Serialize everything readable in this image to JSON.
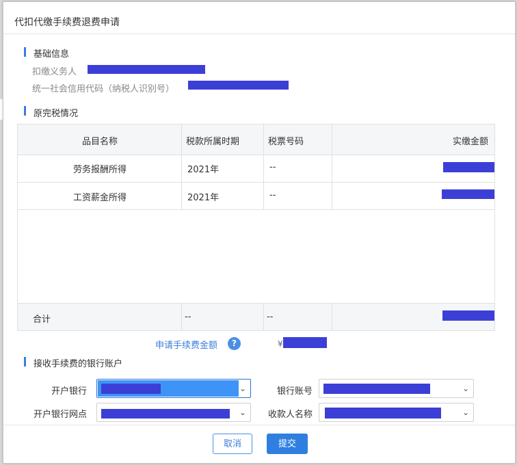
{
  "dialog": {
    "title": "代扣代缴手续费退费申请"
  },
  "basic_info": {
    "section_title": "基础信息",
    "withholder_label": "扣缴义务人",
    "credit_code_label": "统一社会信用代码（纳税人识别号）"
  },
  "tax_status": {
    "section_title": "原完税情况",
    "headers": [
      "品目名称",
      "税款所属时期",
      "税票号码",
      "实缴金额"
    ],
    "rows": [
      {
        "item": "劳务报酬所得",
        "period": "2021年",
        "ticket": "--"
      },
      {
        "item": "工资薪金所得",
        "period": "2021年",
        "ticket": "--"
      }
    ],
    "total": {
      "label": "合计",
      "period": "--",
      "ticket": "--"
    }
  },
  "fee": {
    "label": "申请手续费金额",
    "help_icon": "?",
    "currency": "¥"
  },
  "bank": {
    "section_title": "接收手续费的银行账户",
    "bank_label": "开户银行",
    "account_label": "银行账号",
    "branch_label": "开户银行网点",
    "payee_label": "收款人名称"
  },
  "buttons": {
    "cancel": "取消",
    "submit": "提交"
  },
  "colors": {
    "accent": "#3b7ddc",
    "redaction": "#3c3fd6",
    "selected_field": "#3d94f6"
  }
}
